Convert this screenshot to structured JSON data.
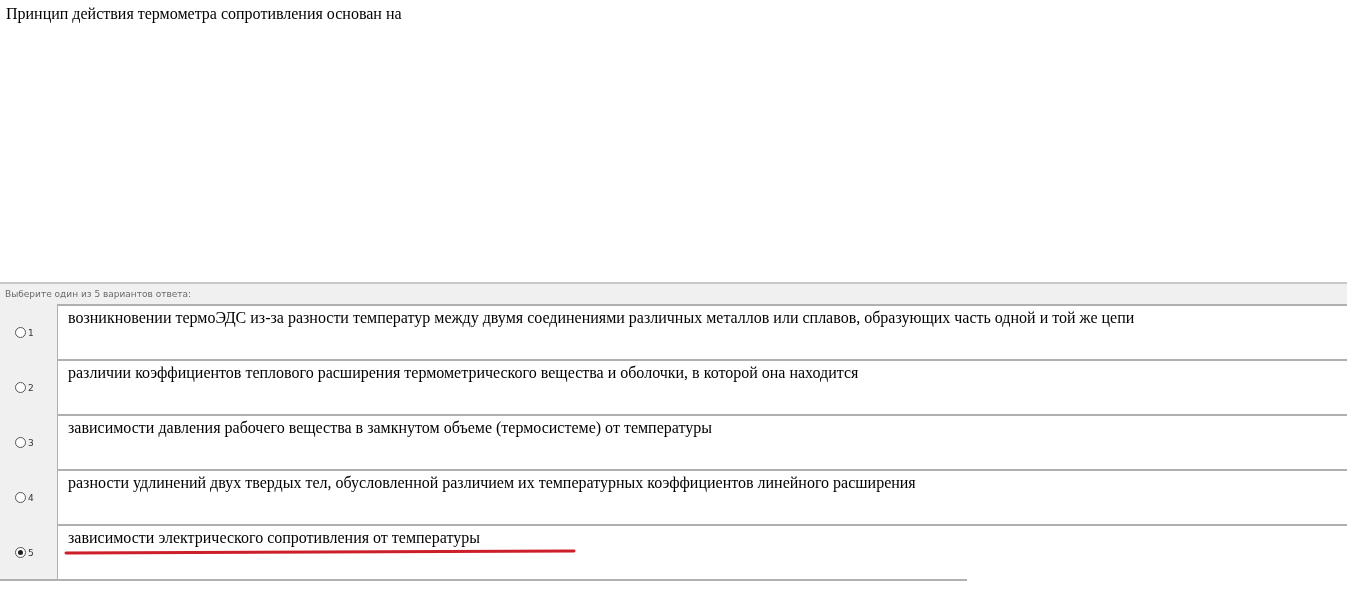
{
  "question": "Принцип действия термометра сопротивления основан на",
  "answers_header": "Выберите один из 5 вариантов ответа:",
  "options": [
    {
      "number": "1",
      "text": "возникновении термоЭДС из-за разности температур между двумя соединениями различных металлов или сплавов, образующих часть одной и той же цепи",
      "selected": false,
      "underlined": false
    },
    {
      "number": "2",
      "text": "различии коэффициентов теплового расширения термометрического вещества и оболочки, в которой она находится",
      "selected": false,
      "underlined": false
    },
    {
      "number": "3",
      "text": "зависимости давления рабочего вещества в замкнутом объеме (термосистеме) от температуры",
      "selected": false,
      "underlined": false
    },
    {
      "number": "4",
      "text": "разности удлинений двух твердых тел, обусловленной различием их температурных коэффициентов линейного расширения",
      "selected": false,
      "underlined": false
    },
    {
      "number": "5",
      "text": "зависимости электрического сопротивления от температуры",
      "selected": true,
      "underlined": true
    }
  ]
}
